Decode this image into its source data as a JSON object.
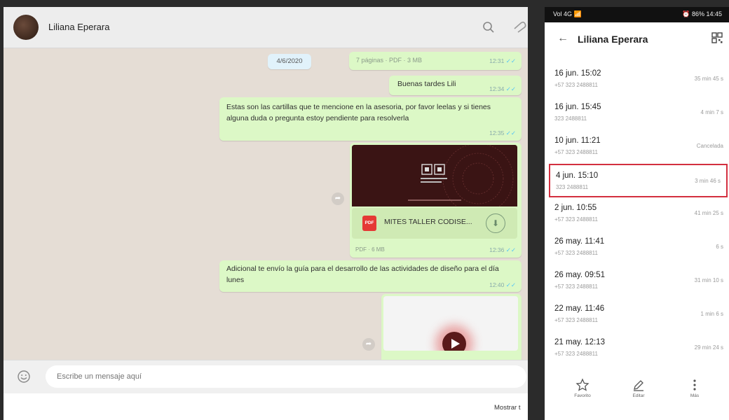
{
  "chat": {
    "contact_name": "Liliana Eperara",
    "date_chip": "4/6/2020",
    "messages": [
      {
        "text": "7 páginas · PDF · 3 MB",
        "time": "12:31"
      },
      {
        "text": "Buenas tardes Lili",
        "time": "12:34"
      },
      {
        "text": "Estas son las cartillas que te mencione en la asesoria, por favor leelas y si tienes alguna duda o pregunta estoy pendiente para resolverla",
        "time": "12:35"
      },
      {
        "pdf_name": "MITES TALLER CODISE...",
        "pdf_badge": "PDF",
        "pdf_meta": "PDF · 6 MB",
        "time": "12:36"
      },
      {
        "text": "Adicional te envío la guía para el desarrollo de las actividades de diseño para el día lunes",
        "time": "12:40"
      }
    ],
    "input_placeholder": "Escribe un mensaje aquí",
    "show_more": "Mostrar t"
  },
  "phone": {
    "status_left": "Vol 4G 📶",
    "status_right": "⏰ 86% 14:45",
    "title": "Liliana Eperara",
    "calls": [
      {
        "date": "16 jun. 15:02",
        "number": "+57 323 2488811",
        "duration": "35 min 45 s"
      },
      {
        "date": "16 jun. 15:45",
        "number": "323 2488811",
        "duration": "4 min 7 s"
      },
      {
        "date": "10 jun. 11:21",
        "number": "+57 323 2488811",
        "duration": "Cancelada"
      },
      {
        "date": "4 jun. 15:10",
        "number": "323 2488811",
        "duration": "3 min 46 s"
      },
      {
        "date": "2 jun. 10:55",
        "number": "+57 323 2488811",
        "duration": "41 min 25 s"
      },
      {
        "date": "26 may. 11:41",
        "number": "+57 323 2488811",
        "duration": "6 s"
      },
      {
        "date": "26 may. 09:51",
        "number": "+57 323 2488811",
        "duration": "31 min 10 s"
      },
      {
        "date": "22 may. 11:46",
        "number": "+57 323 2488811",
        "duration": "1 min 6 s"
      },
      {
        "date": "21 may. 12:13",
        "number": "+57 323 2488811",
        "duration": "29 min 24 s"
      }
    ],
    "actions": [
      {
        "label": "Favorito",
        "icon": "star-icon"
      },
      {
        "label": "Editar",
        "icon": "edit-icon"
      },
      {
        "label": "Más",
        "icon": "more-icon"
      }
    ]
  }
}
